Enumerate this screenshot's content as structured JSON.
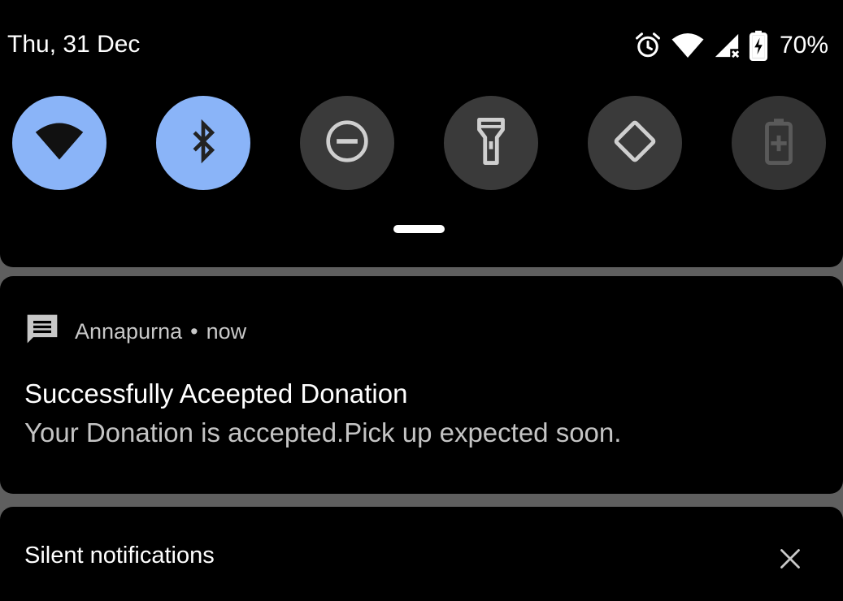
{
  "status_bar": {
    "date": "Thu, 31 Dec",
    "battery_percent": "70%",
    "icons": [
      "alarm-icon",
      "wifi-icon",
      "cell-signal-no-data-icon",
      "battery-charging-icon"
    ]
  },
  "quick_settings": {
    "tiles": [
      {
        "name": "wifi",
        "icon": "wifi-icon",
        "state": "on"
      },
      {
        "name": "bluetooth",
        "icon": "bluetooth-icon",
        "state": "on"
      },
      {
        "name": "do-not-disturb",
        "icon": "do-not-disturb-icon",
        "state": "off"
      },
      {
        "name": "flashlight",
        "icon": "flashlight-icon",
        "state": "off"
      },
      {
        "name": "auto-rotate",
        "icon": "auto-rotate-icon",
        "state": "off"
      },
      {
        "name": "battery-saver",
        "icon": "battery-saver-icon",
        "state": "disabled"
      }
    ],
    "colors": {
      "on": "#8ab4f8",
      "off": "#3a3a3a",
      "disabled": "#333333"
    }
  },
  "notification": {
    "app_icon": "message-icon",
    "app_name": "Annapurna",
    "separator": "•",
    "time": "now",
    "title": "Successfully Aceepted Donation",
    "body": "Your Donation is accepted.Pick up expected soon."
  },
  "silent_section": {
    "title": "Silent notifications",
    "close_icon": "close-icon"
  }
}
